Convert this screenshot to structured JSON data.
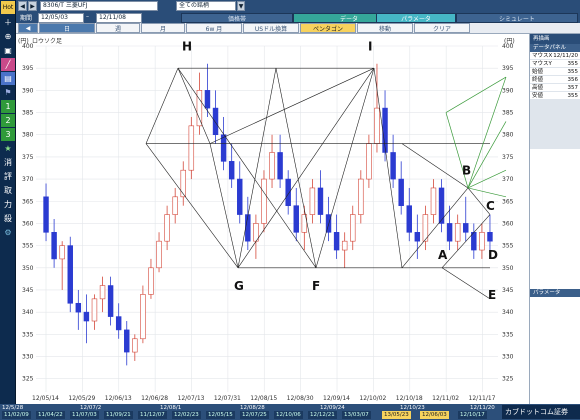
{
  "header": {
    "hot_label": "Hot",
    "ticker": "8306/T 三菱UFJ",
    "scope": "全ての銘柄",
    "period_label": "期間",
    "date_from": "12/05/03",
    "date_to": "12/11/08",
    "menu": [
      "価格帯",
      "データ",
      "パラメータ",
      "シミュレート"
    ]
  },
  "tabs": [
    "日",
    "週",
    "月",
    "6w 月",
    "USドル換算",
    "ペンタゴン",
    "移動",
    "クリア"
  ],
  "chart": {
    "title": "ロウソク足",
    "unit": "(円)",
    "y_ticks": [
      "400",
      "395",
      "390",
      "385",
      "380",
      "375",
      "370",
      "365",
      "360",
      "355",
      "350",
      "345",
      "340",
      "335",
      "330",
      "325"
    ],
    "x_ticks": [
      "12/05/14",
      "12/05/29",
      "12/06/13",
      "12/06/28",
      "12/07/13",
      "12/07/31",
      "12/08/15",
      "12/08/30",
      "12/09/14",
      "12/10/02",
      "12/10/18",
      "12/11/02",
      "12/11/17"
    ],
    "labels": [
      "H",
      "I",
      "G",
      "F",
      "A",
      "B",
      "C",
      "D",
      "E"
    ]
  },
  "chart_data": {
    "type": "candlestick",
    "title": "ロウソク足",
    "ylabel": "(円)",
    "ylim": [
      322,
      400
    ],
    "x_tick_labels": [
      "12/05/14",
      "12/05/29",
      "12/06/13",
      "12/06/28",
      "12/07/13",
      "12/07/31",
      "12/08/15",
      "12/08/30",
      "12/09/14",
      "12/10/02",
      "12/10/18",
      "12/11/02",
      "12/11/17"
    ],
    "points": {
      "H": 395,
      "I": 395,
      "G": 350,
      "F": 350,
      "A": 356,
      "B": 368,
      "C": 362,
      "D": 352,
      "E": 343
    },
    "candles": [
      [
        366,
        369,
        356,
        358
      ],
      [
        358,
        361,
        350,
        352
      ],
      [
        352,
        356,
        345,
        355
      ],
      [
        355,
        357,
        340,
        342
      ],
      [
        342,
        345,
        336,
        340
      ],
      [
        340,
        344,
        333,
        338
      ],
      [
        338,
        344,
        336,
        343
      ],
      [
        343,
        348,
        340,
        346
      ],
      [
        346,
        348,
        337,
        339
      ],
      [
        339,
        342,
        334,
        336
      ],
      [
        336,
        338,
        328,
        331
      ],
      [
        331,
        335,
        329,
        334
      ],
      [
        334,
        346,
        333,
        344
      ],
      [
        344,
        352,
        343,
        350
      ],
      [
        350,
        358,
        349,
        356
      ],
      [
        356,
        364,
        354,
        362
      ],
      [
        362,
        368,
        360,
        366
      ],
      [
        366,
        374,
        364,
        372
      ],
      [
        372,
        384,
        370,
        382
      ],
      [
        382,
        394,
        380,
        390
      ],
      [
        390,
        396,
        384,
        386
      ],
      [
        386,
        390,
        378,
        380
      ],
      [
        380,
        384,
        372,
        374
      ],
      [
        374,
        378,
        368,
        370
      ],
      [
        370,
        374,
        360,
        362
      ],
      [
        362,
        366,
        354,
        356
      ],
      [
        356,
        362,
        352,
        360
      ],
      [
        360,
        372,
        358,
        370
      ],
      [
        370,
        380,
        368,
        376
      ],
      [
        376,
        380,
        368,
        370
      ],
      [
        370,
        372,
        362,
        364
      ],
      [
        364,
        368,
        356,
        358
      ],
      [
        358,
        364,
        354,
        362
      ],
      [
        362,
        370,
        360,
        368
      ],
      [
        368,
        372,
        360,
        362
      ],
      [
        362,
        366,
        356,
        358
      ],
      [
        358,
        362,
        352,
        354
      ],
      [
        354,
        358,
        350,
        356
      ],
      [
        356,
        364,
        354,
        362
      ],
      [
        362,
        372,
        360,
        370
      ],
      [
        370,
        380,
        368,
        378
      ],
      [
        378,
        396,
        376,
        386
      ],
      [
        386,
        390,
        374,
        376
      ],
      [
        376,
        380,
        368,
        370
      ],
      [
        370,
        374,
        362,
        364
      ],
      [
        364,
        368,
        356,
        358
      ],
      [
        358,
        362,
        352,
        356
      ],
      [
        356,
        364,
        354,
        362
      ],
      [
        362,
        370,
        360,
        368
      ],
      [
        368,
        370,
        358,
        360
      ],
      [
        360,
        364,
        354,
        356
      ],
      [
        356,
        362,
        354,
        360
      ],
      [
        360,
        366,
        356,
        358
      ],
      [
        358,
        360,
        352,
        354
      ],
      [
        354,
        360,
        352,
        358
      ],
      [
        358,
        362,
        354,
        356
      ]
    ]
  },
  "panel": {
    "title": "再描画",
    "sub": "データパネル",
    "rows": [
      {
        "k": "マウスX",
        "v": "12/11/20"
      },
      {
        "k": "マウスY",
        "v": "355"
      },
      {
        "k": "始値",
        "v": "355"
      },
      {
        "k": "終値",
        "v": "356"
      },
      {
        "k": "高値",
        "v": "357"
      },
      {
        "k": "安値",
        "v": "355"
      }
    ],
    "param_title": "パラメータ"
  },
  "bottom": {
    "top_ticks": [
      "12/5/28",
      "12/07/2",
      "12/08/1",
      "12/08/28",
      "12/09/24",
      "12/10/23",
      "12/11/20"
    ],
    "segments": [
      "11/02/09",
      "11/04/22",
      "11/07/03",
      "11/09/21",
      "11/12/07",
      "12/02/23",
      "12/05/15",
      "12/07/25",
      "12/10/06",
      "12/12/21",
      "13/03/07",
      "13/05/23",
      "12/06/03",
      "12/10/17"
    ],
    "brand": "カブドットコム証券"
  },
  "colors": {
    "up": "#d4483a",
    "down": "#2b3bd1",
    "line": "#222",
    "green": "#3a9a3a"
  }
}
